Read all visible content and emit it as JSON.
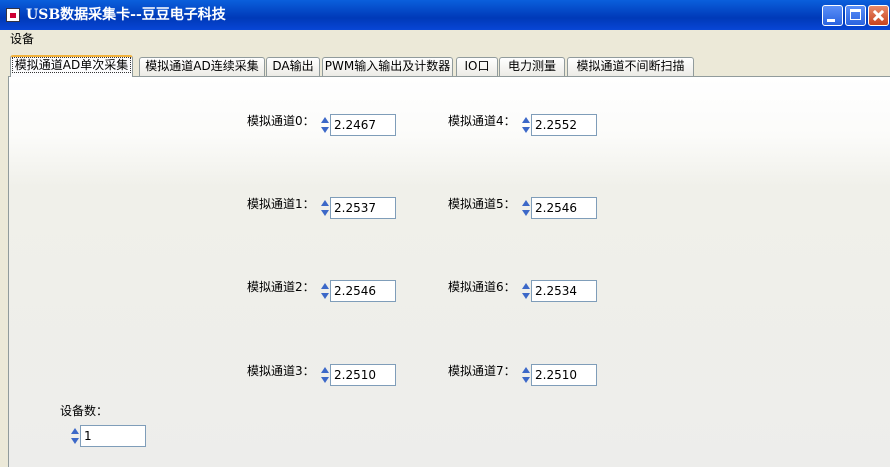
{
  "window": {
    "title": "USB数据采集卡--豆豆电子科技"
  },
  "menu": {
    "items": [
      "设备"
    ]
  },
  "tabs": [
    "模拟通道AD单次采集",
    "模拟通道AD连续采集",
    "DA输出",
    "PWM输入输出及计数器",
    "IO口",
    "电力测量",
    "模拟通道不间断扫描"
  ],
  "active_tab": "模拟通道AD单次采集",
  "channels": [
    {
      "label": "模拟通道0：",
      "value": "2.2467"
    },
    {
      "label": "模拟通道1：",
      "value": "2.2537"
    },
    {
      "label": "模拟通道2：",
      "value": "2.2546"
    },
    {
      "label": "模拟通道3：",
      "value": "2.2510"
    },
    {
      "label": "模拟通道4：",
      "value": "2.2552"
    },
    {
      "label": "模拟通道5：",
      "value": "2.2546"
    },
    {
      "label": "模拟通道6：",
      "value": "2.2534"
    },
    {
      "label": "模拟通道7：",
      "value": "2.2510"
    }
  ],
  "device_count": {
    "label": "设备数：",
    "value": "1"
  },
  "colors": {
    "titlebar": "#0a5fdc",
    "active_tab_accent": "#f1b13b",
    "spin_arrow": "#3c68c8"
  },
  "icons": {
    "app": "app-icon",
    "minimize": "minimize-icon",
    "maximize": "maximize-icon",
    "close": "close-icon"
  }
}
